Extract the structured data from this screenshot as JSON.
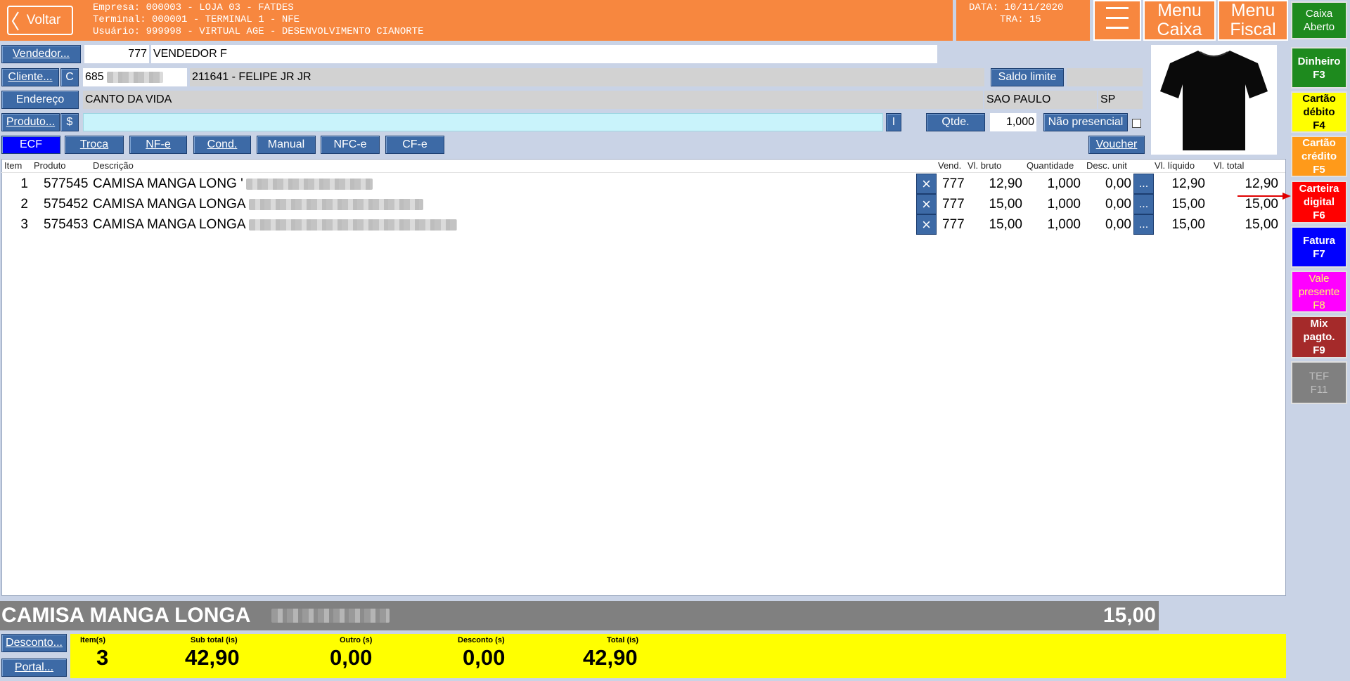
{
  "header": {
    "back_label": "Voltar",
    "info_lines": [
      "Empresa: 000003 - LOJA 03 - FATDES",
      "Terminal: 000001 - TERMINAL 1 - NFE",
      "Usuário: 999998 - VIRTUAL AGE - DESENVOLVIMENTO CIANORTE"
    ],
    "date_line": "DATA: 10/11/2020",
    "tra_line": "TRA: 15",
    "menu_caixa": [
      "Menu",
      "Caixa"
    ],
    "menu_fiscal": [
      "Menu",
      "Fiscal"
    ],
    "caixa_status": [
      "Caixa",
      "Aberto"
    ]
  },
  "form": {
    "vendedor_label": "Vendedor...",
    "vendedor_code": "777",
    "vendedor_name": "VENDEDOR F",
    "cliente_label": "Cliente...",
    "cliente_c": "C",
    "cliente_doc": "685",
    "cliente_name": "211641 - FELIPE JR JR",
    "saldo_label": "Saldo limite",
    "endereco_label": "Endereço",
    "endereco_value": "CANTO DA VIDA",
    "cidade": "SAO PAULO",
    "uf": "SP",
    "produto_label": "Produto...",
    "produto_dollar": "$",
    "produto_value": "",
    "i_button": "I",
    "qtde_label": "Qtde.",
    "qtde_value": "1,000",
    "nao_presencial_label": "Não presencial",
    "voucher_label": "Voucher"
  },
  "doc_tabs": [
    "ECF",
    "Troca",
    "NF-e",
    "Cond.",
    "Manual",
    "NFC-e",
    "CF-e"
  ],
  "table": {
    "headers": [
      "Item",
      "Produto",
      "Descrição",
      "Vend.",
      "Vl. bruto",
      "Quantidade",
      "Desc. unit",
      "Vl. líquido",
      "Vl. total"
    ],
    "rows": [
      {
        "item": "1",
        "produto": "577545",
        "descricao": "CAMISA MANGA LONG '",
        "vend": "777",
        "bruto": "12,90",
        "qtd": "1,000",
        "desc": "0,00",
        "liquido": "12,90",
        "total": "12,90"
      },
      {
        "item": "2",
        "produto": "575452",
        "descricao": "CAMISA MANGA LONGA",
        "vend": "777",
        "bruto": "15,00",
        "qtd": "1,000",
        "desc": "0,00",
        "liquido": "15,00",
        "total": "15,00"
      },
      {
        "item": "3",
        "produto": "575453",
        "descricao": "CAMISA MANGA LONGA",
        "vend": "777",
        "bruto": "15,00",
        "qtd": "1,000",
        "desc": "0,00",
        "liquido": "15,00",
        "total": "15,00"
      }
    ]
  },
  "current_product": {
    "name": "CAMISA MANGA LONGA",
    "price": "15,00"
  },
  "footer": {
    "desconto_label": "Desconto...",
    "portal_label": "Portal...",
    "labels": [
      "Item(s)",
      "Sub total (is)",
      "Outro (s)",
      "Desconto (s)",
      "Total (is)"
    ],
    "values": [
      "3",
      "42,90",
      "0,00",
      "0,00",
      "42,90"
    ]
  },
  "payments": [
    {
      "lines": [
        "Dinheiro",
        "F3"
      ],
      "bg": "#1e8a1e",
      "fg": "#ffffff"
    },
    {
      "lines": [
        "Cartão",
        "débito",
        "F4"
      ],
      "bg": "#ffff00",
      "fg": "#000000"
    },
    {
      "lines": [
        "Cartão",
        "crédito",
        "F5"
      ],
      "bg": "#ff9a1a",
      "fg": "#ffffff"
    },
    {
      "lines": [
        "Carteira",
        "digital",
        "F6"
      ],
      "bg": "#ff0000",
      "fg": "#ffffff"
    },
    {
      "lines": [
        "Fatura",
        "F7"
      ],
      "bg": "#0000ff",
      "fg": "#ffffff"
    },
    {
      "lines": [
        "Vale",
        "presente",
        "F8"
      ],
      "bg": "#ff00ff",
      "fg": "#ffff66"
    },
    {
      "lines": [
        "Mix",
        "pagto.",
        "F9"
      ],
      "bg": "#a52a2a",
      "fg": "#ffffff"
    },
    {
      "lines": [
        "TEF",
        "F11"
      ],
      "bg": "#808080",
      "fg": "#bdbdbd"
    }
  ]
}
